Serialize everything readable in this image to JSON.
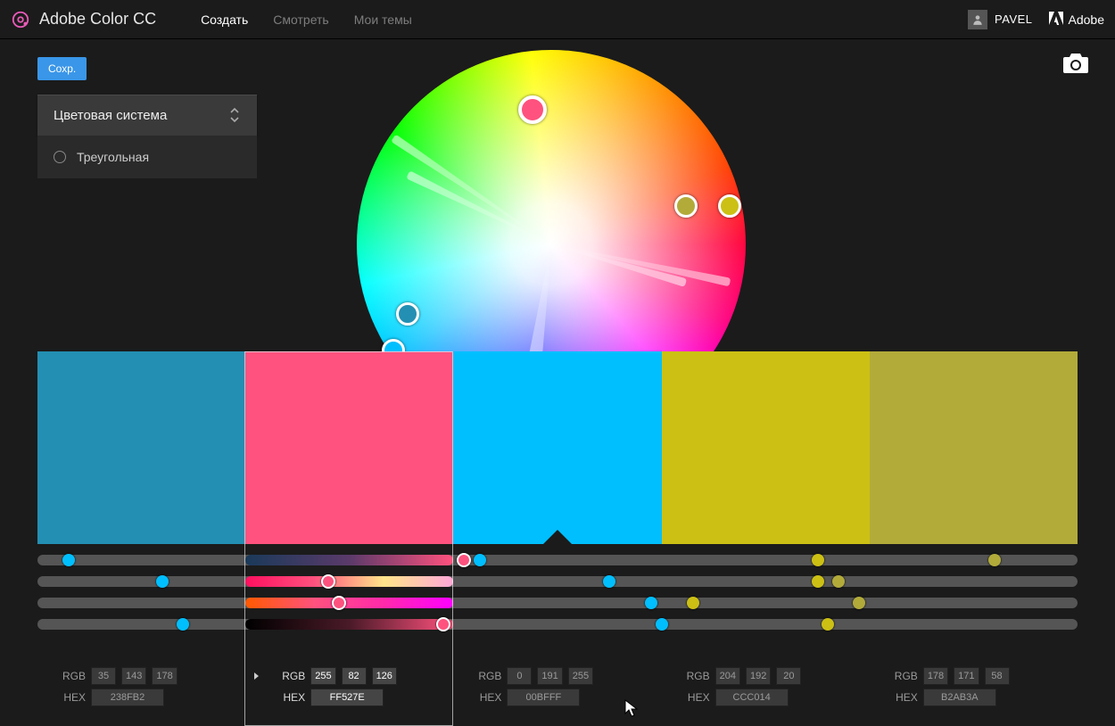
{
  "header": {
    "app_title": "Adobe Color CC",
    "tabs": [
      {
        "label": "Создать",
        "active": true
      },
      {
        "label": "Смотреть",
        "active": false
      },
      {
        "label": "Мои темы",
        "active": false
      }
    ],
    "user": "PAVEL",
    "brand": "Adobe"
  },
  "toolbar": {
    "save_label": "Сохр."
  },
  "sidebar": {
    "heading": "Цветовая система",
    "rule": "Треугольная"
  },
  "wheel": {
    "markers": [
      {
        "angle_deg": 78,
        "radius_pct": 94,
        "color": "#ccc014"
      },
      {
        "angle_deg": 74,
        "radius_pct": 72,
        "color": "#b2ab3a"
      },
      {
        "angle_deg": 244,
        "radius_pct": 82,
        "color": "#238fb2"
      },
      {
        "angle_deg": 236,
        "radius_pct": 98,
        "color": "#00bfff"
      },
      {
        "angle_deg": 352,
        "radius_pct": 70,
        "color": "#ff527e",
        "base": true
      }
    ]
  },
  "swatches": [
    {
      "hex": "#238FB2"
    },
    {
      "hex": "#FF527E",
      "selected": true
    },
    {
      "hex": "#00BFFF",
      "base": true
    },
    {
      "hex": "#CCC014"
    },
    {
      "hex": "#B2AB3A"
    }
  ],
  "sliders": {
    "rows": 4,
    "thumbs": [
      [
        {
          "p": 3,
          "c": "#00bfff"
        },
        {
          "p": 41,
          "c": "#ff527e",
          "ring": true
        },
        {
          "p": 42.5,
          "c": "#00bfff"
        },
        {
          "p": 75,
          "c": "#ccc014"
        },
        {
          "p": 92,
          "c": "#b2ab3a"
        }
      ],
      [
        {
          "p": 12,
          "c": "#00bfff"
        },
        {
          "p": 28,
          "c": "#ff527e",
          "ring": true
        },
        {
          "p": 55,
          "c": "#00bfff"
        },
        {
          "p": 75,
          "c": "#ccc014"
        },
        {
          "p": 77,
          "c": "#b2ab3a"
        }
      ],
      [
        {
          "p": 29,
          "c": "#ff527e",
          "ring": true
        },
        {
          "p": 59,
          "c": "#00bfff"
        },
        {
          "p": 63,
          "c": "#ccc014"
        },
        {
          "p": 79,
          "c": "#b2ab3a"
        }
      ],
      [
        {
          "p": 14,
          "c": "#00bfff"
        },
        {
          "p": 39,
          "c": "#ff527e",
          "ring": true
        },
        {
          "p": 60,
          "c": "#00bfff"
        },
        {
          "p": 76,
          "c": "#ccc014"
        }
      ]
    ],
    "selected_gradients": [
      "linear-gradient(90deg,#1a3a5a,#5a3a6a,#ff527e)",
      "linear-gradient(90deg,#ff1060,#ff527e,#ffe58a,#ffa8d8)",
      "linear-gradient(90deg,#ff5a00,#ff527e,#ff2aaa,#ff00ff)",
      "linear-gradient(90deg,#000000,#4a1a28,#ff527e)"
    ]
  },
  "values": {
    "rgb_label": "RGB",
    "hex_label": "HEX",
    "cols": [
      {
        "rgb": [
          "35",
          "143",
          "178"
        ],
        "hex": "238FB2",
        "active": false
      },
      {
        "rgb": [
          "255",
          "82",
          "126"
        ],
        "hex": "FF527E",
        "active": true
      },
      {
        "rgb": [
          "0",
          "191",
          "255"
        ],
        "hex": "00BFFF",
        "active": false
      },
      {
        "rgb": [
          "204",
          "192",
          "20"
        ],
        "hex": "CCC014",
        "active": false
      },
      {
        "rgb": [
          "178",
          "171",
          "58"
        ],
        "hex": "B2AB3A",
        "active": false
      }
    ]
  }
}
